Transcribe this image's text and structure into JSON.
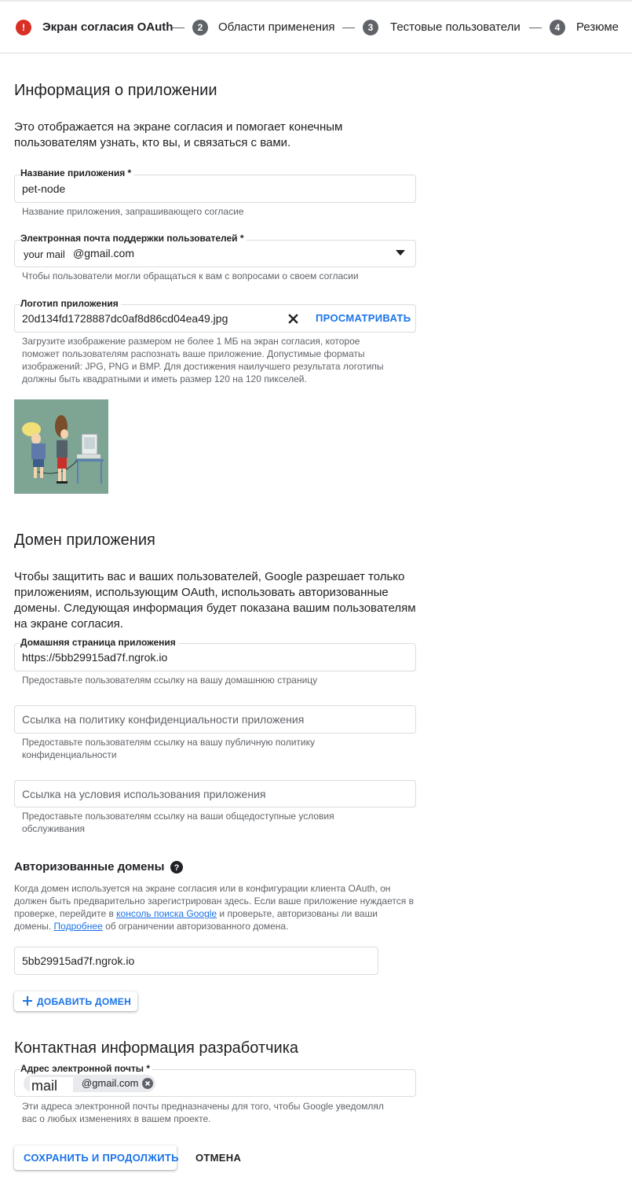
{
  "stepper": {
    "steps": [
      {
        "number": "!",
        "label": "Экран согласия OAuth",
        "state": "error-active"
      },
      {
        "number": "2",
        "label": "Области применения"
      },
      {
        "number": "3",
        "label": "Тестовые пользователи"
      },
      {
        "number": "4",
        "label": "Резюме"
      }
    ]
  },
  "app_info": {
    "title": "Информация о приложении",
    "description": "Это отображается на экране согласия и помогает конечным пользователям узнать, кто вы, и связаться с вами.",
    "app_name": {
      "label": "Название приложения *",
      "value": "pet-node",
      "hint": "Название приложения, запрашивающего согласие"
    },
    "support_email": {
      "label": "Электронная почта поддержки пользователей *",
      "value_prefix": "your mail",
      "value": "@gmail.com",
      "hint": "Чтобы пользователи могли обращаться к вам с вопросами о своем согласии"
    },
    "logo": {
      "label": "Логотип приложения",
      "value": "20d134fd1728887dc0af8d86cd04ea49.jpg",
      "browse_label": "ПРОСМАТРИВАТЬ",
      "hint": "Загрузите изображение размером не более 1 МБ на экран согласия, которое поможет пользователям распознать ваше приложение. Допустимые форматы изображений: JPG, PNG и BMP. Для достижения наилучшего результата логотипы должны быть квадратными и иметь размер 120 на 120 пикселей."
    }
  },
  "app_domain": {
    "title": "Домен приложения",
    "description": "Чтобы защитить вас и ваших пользователей, Google разрешает только приложениям, использующим OAuth, использовать авторизованные домены. Следующая информация будет показана вашим пользователям на экране согласия.",
    "homepage": {
      "label": "Домашняя страница приложения",
      "value": "https://5bb29915ad7f.ngrok.io",
      "hint": "Предоставьте пользователям ссылку на вашу домашнюю страницу"
    },
    "privacy": {
      "placeholder": "Ссылка на политику конфиденциальности приложения",
      "hint": "Предоставьте пользователям ссылку на вашу публичную политику конфиденциальности"
    },
    "terms": {
      "placeholder": "Ссылка на условия использования приложения",
      "hint": "Предоставьте пользователям ссылку на ваши общедоступные условия обслуживания"
    }
  },
  "authorized_domains": {
    "title": "Авторизованные домены",
    "desc_1": "Когда домен используется на экране согласия или в конфигурации клиента OAuth, он должен быть предварительно зарегистрирован здесь. Если ваше приложение нуждается в проверке, перейдите в ",
    "link_console": "консоль поиска Google",
    "desc_2": " и проверьте, авторизованы ли ваши домены. ",
    "link_more": "Подробнее",
    "desc_3": " об ограничении авторизованного домена.",
    "domain_value": "5bb29915ad7f.ngrok.io",
    "add_label": "ДОБАВИТЬ ДОМЕН"
  },
  "developer_contact": {
    "title": "Контактная информация разработчика",
    "email_label": "Адрес электронной почты *",
    "chip_prefix": "mail",
    "chip_value": "@gmail.com",
    "hint": "Эти адреса электронной почты предназначены для того, чтобы Google уведомлял вас о любых изменениях в вашем проекте."
  },
  "actions": {
    "save_label": "СОХРАНИТЬ И ПРОДОЛЖИТЬ",
    "cancel_label": "ОТМЕНА"
  },
  "colors": {
    "accent": "#1a73e8",
    "error": "#d93025",
    "step": "#5f6368"
  }
}
